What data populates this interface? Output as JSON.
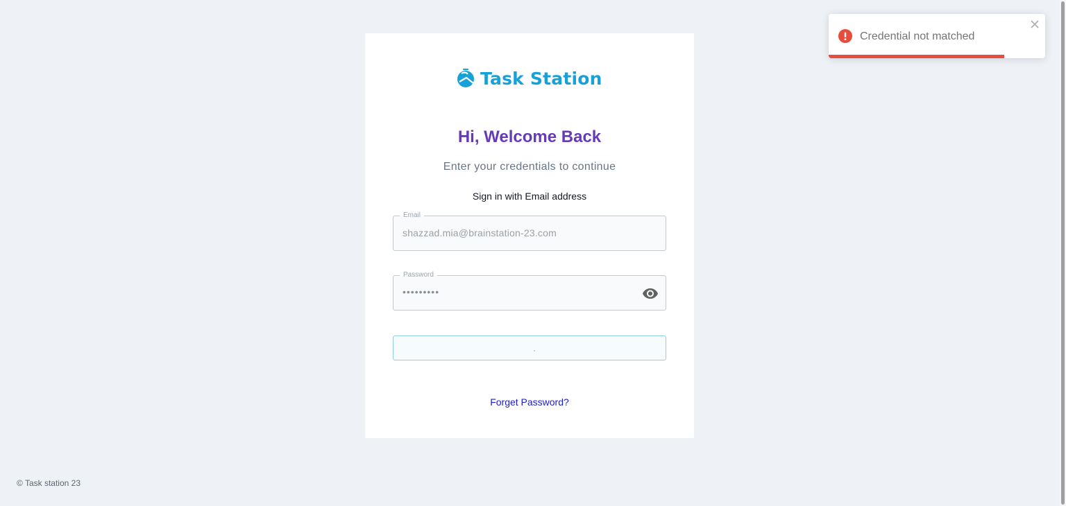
{
  "brand": {
    "name": "Task Station",
    "color": "#17a1d9",
    "icon": "task-station-logo-icon"
  },
  "login": {
    "title": "Hi, Welcome Back",
    "subtitle": "Enter your credentials to continue",
    "signin_label": "Sign in with Email address",
    "email": {
      "label": "Email",
      "value": "shazzad.mia@brainstation-23.com"
    },
    "password": {
      "label": "Password",
      "value": "•••••••••",
      "toggle_icon": "eye-icon"
    },
    "submit": {
      "state": "loading"
    },
    "forget_password": "Forget Password?"
  },
  "toast": {
    "type": "error",
    "icon": "error-icon",
    "message": "Credential not matched",
    "close_icon": "close-icon",
    "progress": 0.81,
    "color": "#e74c3c"
  },
  "footer": {
    "copyright": "© Task station 23"
  },
  "colors": {
    "background": "#eef2f6",
    "title": "#673ab7",
    "link": "#1a1adb"
  }
}
